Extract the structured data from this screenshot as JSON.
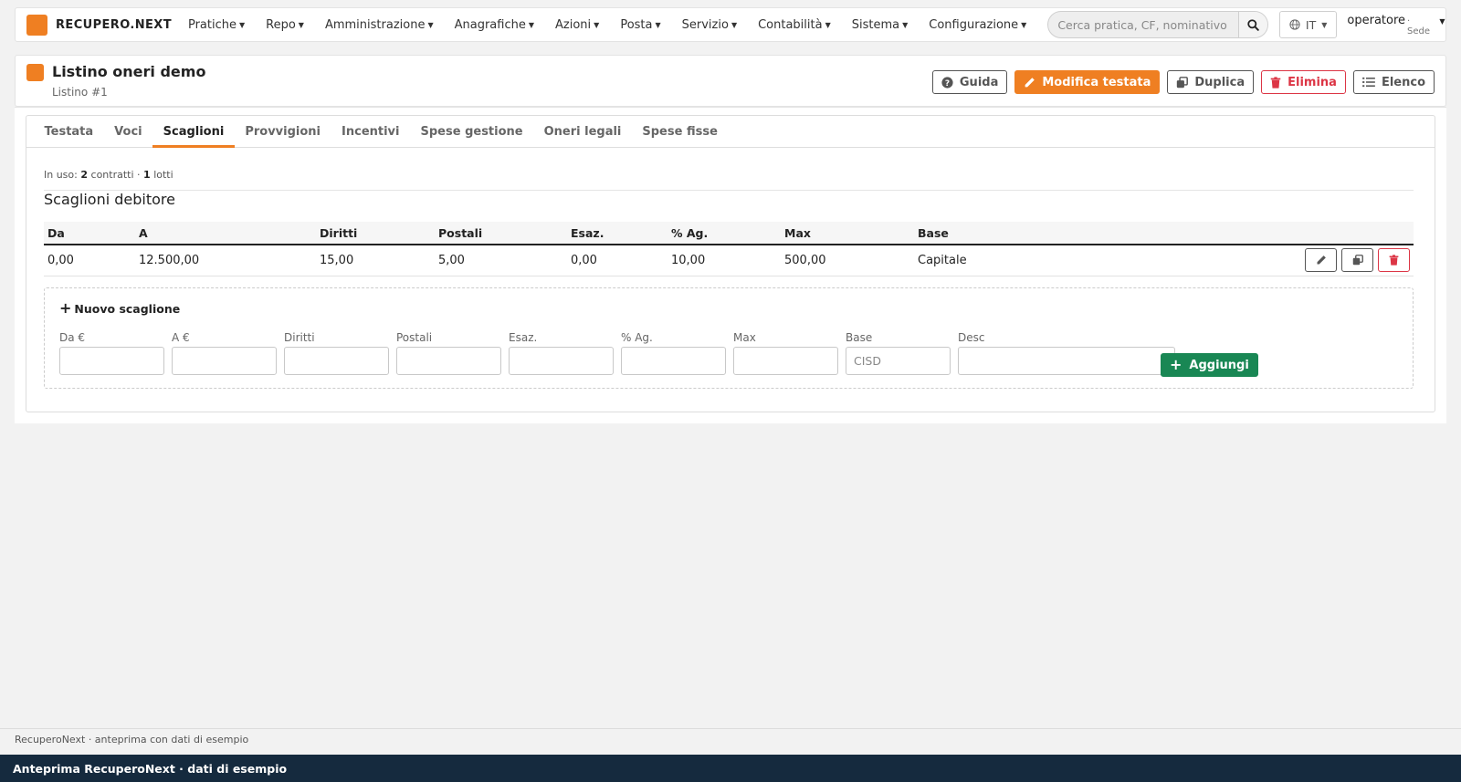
{
  "brand": {
    "name": "RECUPERO.NEXT",
    "color": "#ef7f22"
  },
  "nav": [
    {
      "label": "Pratiche"
    },
    {
      "label": "Repo"
    },
    {
      "label": "Amministrazione"
    },
    {
      "label": "Anagrafiche"
    },
    {
      "label": "Azioni"
    },
    {
      "label": "Posta"
    },
    {
      "label": "Servizio"
    },
    {
      "label": "Contabilità"
    },
    {
      "label": "Sistema"
    },
    {
      "label": "Configurazione"
    }
  ],
  "search": {
    "placeholder": "Cerca pratica, CF, nominativo",
    "icon": "search-icon"
  },
  "lang": {
    "label": "IT",
    "icon": "globe-icon"
  },
  "user": {
    "name": "operatore",
    "sede": "· Sede"
  },
  "header": {
    "title": "Listino oneri demo",
    "subtitle": "Listino #1",
    "actions": {
      "guida": "Guida",
      "modifica": "Modifica testata",
      "duplica": "Duplica",
      "elimina": "Elimina",
      "elenco": "Elenco"
    }
  },
  "tabs": [
    {
      "label": "Testata"
    },
    {
      "label": "Voci"
    },
    {
      "label": "Scaglioni",
      "active": true
    },
    {
      "label": "Provvigioni"
    },
    {
      "label": "Incentivi"
    },
    {
      "label": "Spese gestione"
    },
    {
      "label": "Oneri legali"
    },
    {
      "label": "Spese fisse"
    }
  ],
  "usage": {
    "prefix": "In uso:",
    "contratti_count": "2",
    "contratti_label": "contratti ·",
    "lotti_count": "1",
    "lotti_label": "lotti"
  },
  "section_title": "Scaglioni debitore",
  "table": {
    "columns": [
      "Da",
      "A",
      "Diritti",
      "Postali",
      "Esaz.",
      "% Ag.",
      "Max",
      "Base"
    ],
    "rows": [
      {
        "da": "0,00",
        "a": "12.500,00",
        "diritti": "15,00",
        "postali": "5,00",
        "esaz": "0,00",
        "ag": "10,00",
        "max": "500,00",
        "base": "Capitale"
      }
    ]
  },
  "new_scaglione": {
    "title": "Nuovo scaglione",
    "fields": [
      {
        "label": "Da €",
        "placeholder": ""
      },
      {
        "label": "A €",
        "placeholder": ""
      },
      {
        "label": "Diritti",
        "placeholder": ""
      },
      {
        "label": "Postali",
        "placeholder": ""
      },
      {
        "label": "Esaz.",
        "placeholder": ""
      },
      {
        "label": "% Ag.",
        "placeholder": ""
      },
      {
        "label": "Max",
        "placeholder": ""
      },
      {
        "label": "Base",
        "placeholder": "CISD"
      },
      {
        "label": "Desc",
        "placeholder": ""
      }
    ],
    "submit": "Aggiungi"
  },
  "footer": {
    "text": "RecuperoNext · anteprima con dati di esempio"
  },
  "preview_bar": {
    "text": "Anteprima RecuperoNext · dati di esempio"
  },
  "colors": {
    "accent": "#ef7f22",
    "danger": "#dc3545",
    "success": "#198754",
    "preview_bar": "#152a3e"
  }
}
